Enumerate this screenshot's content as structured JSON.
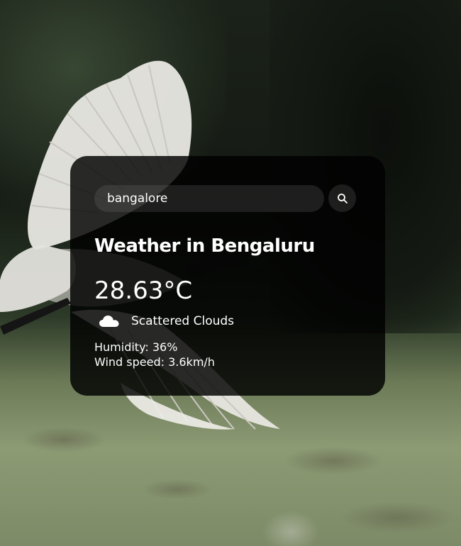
{
  "search": {
    "value": "bangalore",
    "button_icon": "search-icon"
  },
  "weather": {
    "title": "Weather in Bengaluru",
    "temperature": "28.63°C",
    "condition_icon": "cloud-icon",
    "condition": "Scattered Clouds",
    "humidity": "Humidity: 36%",
    "wind": "Wind speed: 3.6km/h"
  },
  "colors": {
    "card_background": "#000000",
    "text": "#ffffff",
    "input_background": "#7d7d7d"
  }
}
